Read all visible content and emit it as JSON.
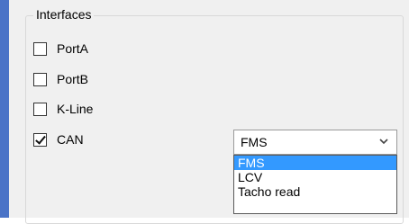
{
  "group": {
    "title": "Interfaces"
  },
  "checkboxes": [
    {
      "label": "PortA",
      "checked": false
    },
    {
      "label": "PortB",
      "checked": false
    },
    {
      "label": "K-Line",
      "checked": false
    },
    {
      "label": "CAN",
      "checked": true
    }
  ],
  "can_protocol": {
    "selected": "FMS",
    "options": [
      "FMS",
      "LCV",
      "Tacho read"
    ],
    "highlighted_option": "FMS"
  },
  "colors": {
    "window_background": "#f0f0f0",
    "accent_bar": "#4a73c7",
    "selection": "#3399ff"
  }
}
